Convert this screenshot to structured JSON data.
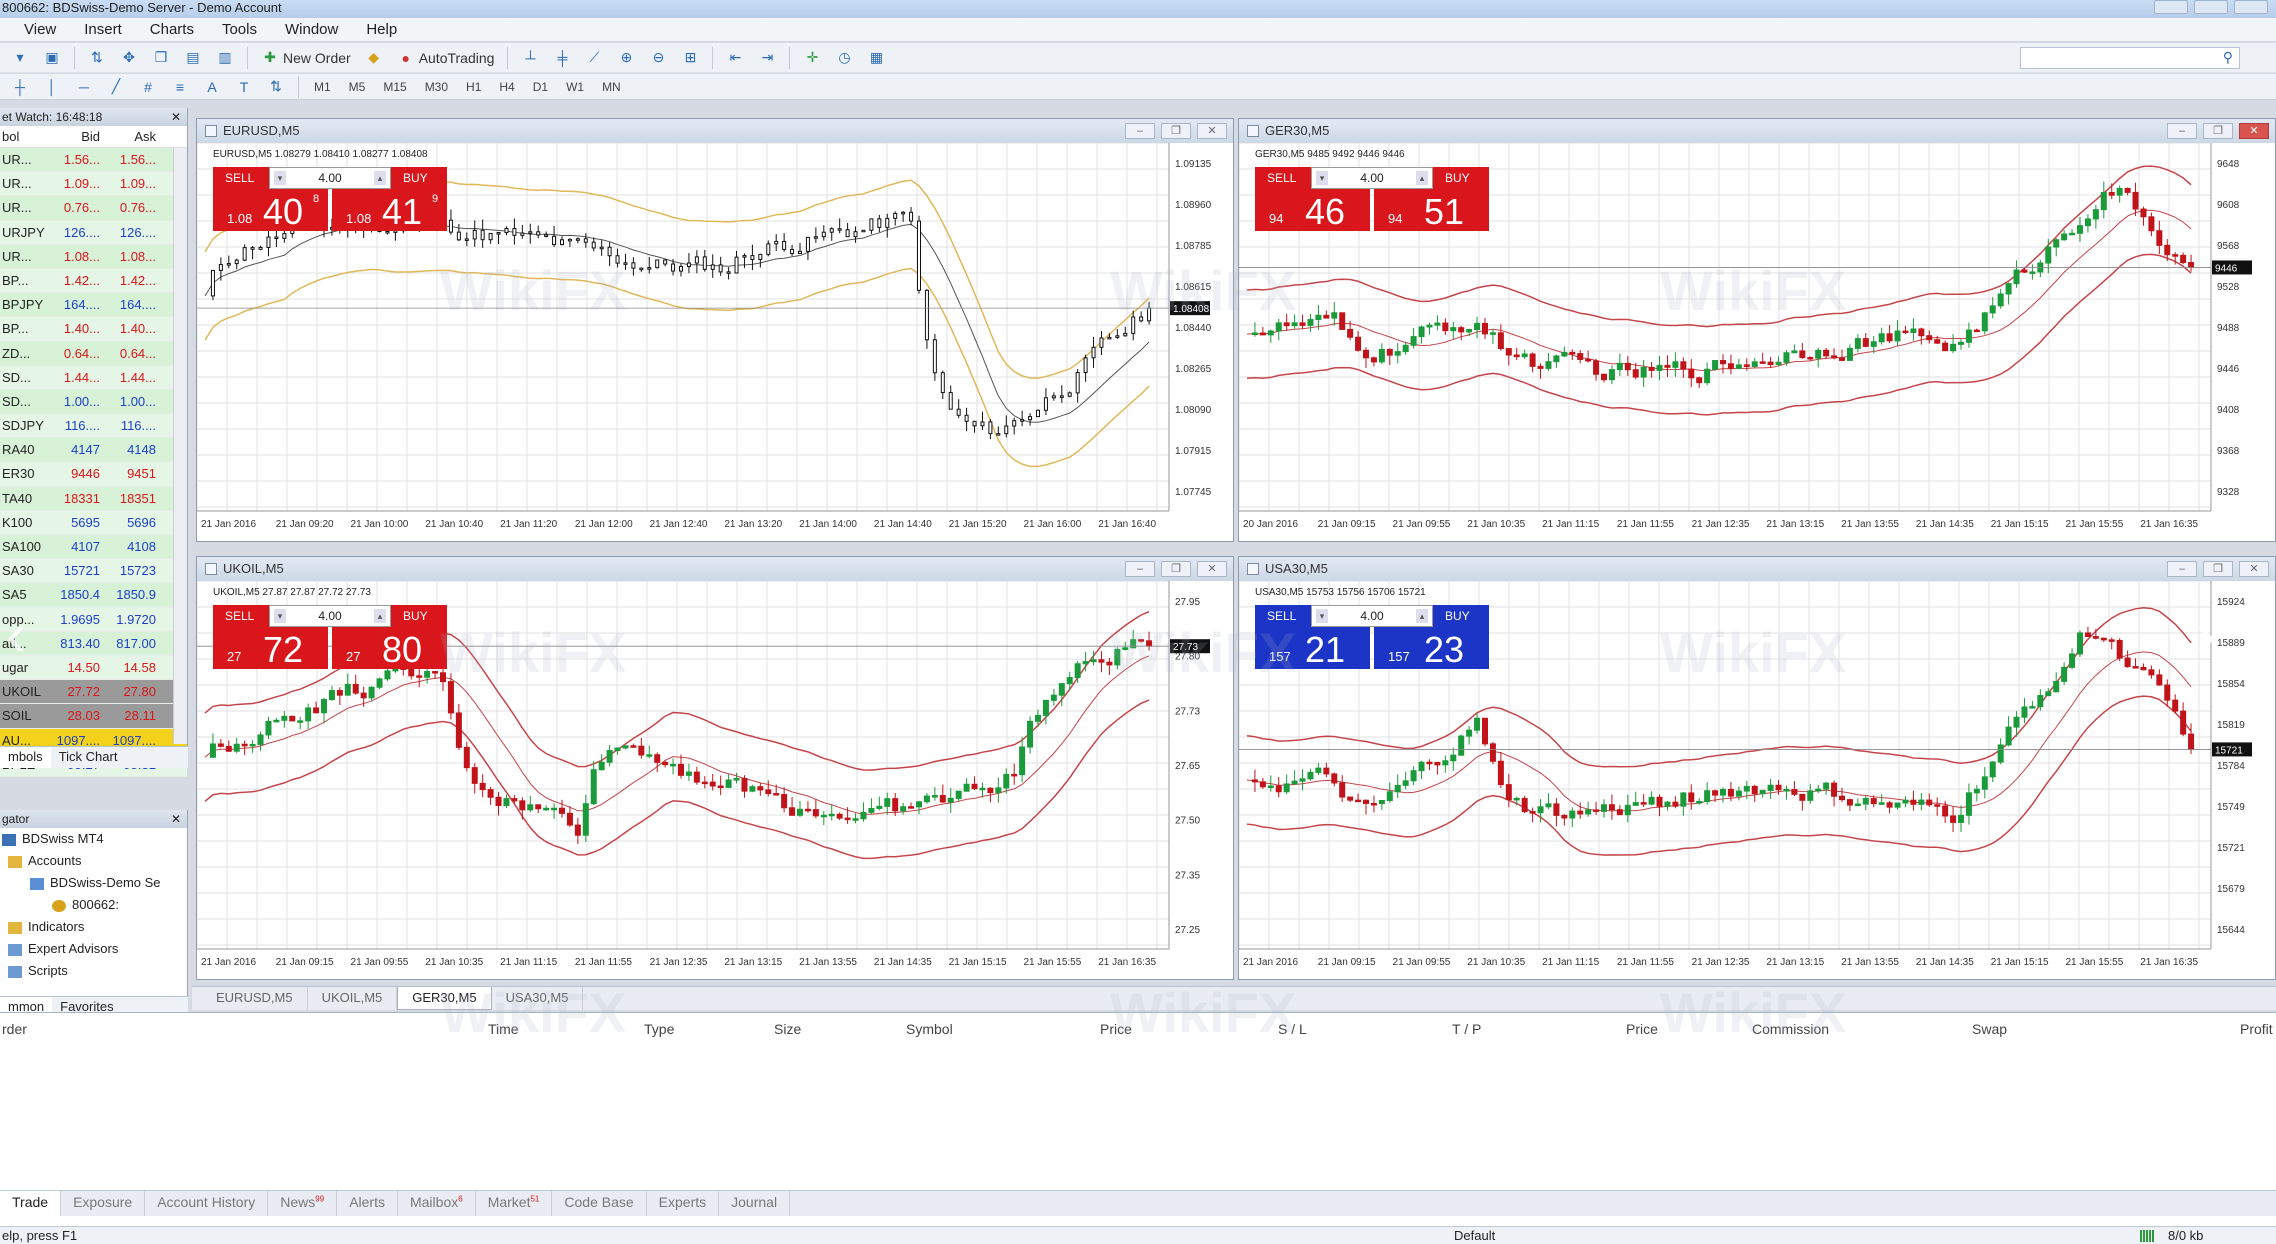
{
  "window": {
    "title": "800662: BDSwiss-Demo Server - Demo Account"
  },
  "menu": [
    "View",
    "Insert",
    "Charts",
    "Tools",
    "Window",
    "Help"
  ],
  "toolbar": {
    "new_order": "New Order",
    "autotrading": "AutoTrading"
  },
  "timeframes": [
    "M1",
    "M5",
    "M15",
    "M30",
    "H1",
    "H4",
    "D1",
    "W1",
    "MN"
  ],
  "market_watch": {
    "title": "et Watch: 16:48:18",
    "headers": {
      "symbol": "bol",
      "bid": "Bid",
      "ask": "Ask"
    },
    "rows": [
      {
        "symbol": "UR...",
        "bid": "1.56...",
        "ask": "1.56...",
        "color": "#d9161b"
      },
      {
        "symbol": "UR...",
        "bid": "1.09...",
        "ask": "1.09...",
        "color": "#d9161b"
      },
      {
        "symbol": "UR...",
        "bid": "0.76...",
        "ask": "0.76...",
        "color": "#d9161b"
      },
      {
        "symbol": "URJPY",
        "bid": "126....",
        "ask": "126....",
        "color": "#1b3fc7"
      },
      {
        "symbol": "UR...",
        "bid": "1.08...",
        "ask": "1.08...",
        "color": "#d9161b"
      },
      {
        "symbol": "BP...",
        "bid": "1.42...",
        "ask": "1.42...",
        "color": "#d9161b"
      },
      {
        "symbol": "BPJPY",
        "bid": "164....",
        "ask": "164....",
        "color": "#1b3fc7"
      },
      {
        "symbol": "BP...",
        "bid": "1.40...",
        "ask": "1.40...",
        "color": "#d9161b"
      },
      {
        "symbol": "ZD...",
        "bid": "0.64...",
        "ask": "0.64...",
        "color": "#d9161b"
      },
      {
        "symbol": "SD...",
        "bid": "1.44...",
        "ask": "1.44...",
        "color": "#d9161b"
      },
      {
        "symbol": "SD...",
        "bid": "1.00...",
        "ask": "1.00...",
        "color": "#1b3fc7"
      },
      {
        "symbol": "SDJPY",
        "bid": "116....",
        "ask": "116....",
        "color": "#1b3fc7"
      },
      {
        "symbol": "RA40",
        "bid": "4147",
        "ask": "4148",
        "color": "#1b3fc7"
      },
      {
        "symbol": "ER30",
        "bid": "9446",
        "ask": "9451",
        "color": "#d9161b"
      },
      {
        "symbol": "TA40",
        "bid": "18331",
        "ask": "18351",
        "color": "#d9161b"
      },
      {
        "symbol": "K100",
        "bid": "5695",
        "ask": "5696",
        "color": "#1b3fc7"
      },
      {
        "symbol": "SA100",
        "bid": "4107",
        "ask": "4108",
        "color": "#1b3fc7"
      },
      {
        "symbol": "SA30",
        "bid": "15721",
        "ask": "15723",
        "color": "#1b3fc7"
      },
      {
        "symbol": "SA5",
        "bid": "1850.4",
        "ask": "1850.9",
        "color": "#1b3fc7"
      },
      {
        "symbol": "opp...",
        "bid": "1.9695",
        "ask": "1.9720",
        "color": "#1b3fc7"
      },
      {
        "symbol": "ati...",
        "bid": "813.40",
        "ask": "817.00",
        "color": "#1b3fc7"
      },
      {
        "symbol": "ugar",
        "bid": "14.50",
        "ask": "14.58",
        "color": "#d9161b"
      },
      {
        "symbol": "UKOIL",
        "bid": "27.72",
        "ask": "27.80",
        "color": "#d9161b"
      },
      {
        "symbol": "SOIL",
        "bid": "28.03",
        "ask": "28.11",
        "color": "#d9161b"
      },
      {
        "symbol": "AU...",
        "bid": "1097....",
        "ask": "1097....",
        "color": "#1b3fc7"
      },
      {
        "symbol": "BPLE",
        "bid": "95.27",
        "ask": "95.31",
        "color": "#1b3fc7"
      }
    ],
    "tabs": [
      "mbols",
      "Tick Chart"
    ]
  },
  "navigator": {
    "title": "gator",
    "items": [
      "BDSwiss MT4",
      "Accounts",
      "BDSwiss-Demo Se",
      "800662:",
      "Indicators",
      "Expert Advisors",
      "Scripts"
    ],
    "tabs": [
      "mmon",
      "Favorites"
    ]
  },
  "charts": [
    {
      "id": "eurusd",
      "title": "EURUSD,M5",
      "info": "EURUSD,M5 1.08279 1.08410 1.08277 1.08408",
      "theme": "red",
      "lot": "4.00",
      "sell_small": "1.08",
      "sell_big": "40",
      "sell_sup": "8",
      "buy_small": "1.08",
      "buy_big": "41",
      "buy_sup": "9",
      "y_ticks": [
        "1.09135",
        "1.08960",
        "1.08785",
        "1.08615",
        "1.08440",
        "1.08265",
        "1.08090",
        "1.07915",
        "1.07745"
      ],
      "current_price": "1.08408",
      "x_ticks": [
        "21 Jan 2016",
        "21 Jan 09:20",
        "21 Jan 10:00",
        "21 Jan 10:40",
        "21 Jan 11:20",
        "21 Jan 12:00",
        "21 Jan 12:40",
        "21 Jan 13:20",
        "21 Jan 14:00",
        "21 Jan 14:40",
        "21 Jan 15:20",
        "21 Jan 16:00",
        "21 Jan 16:40"
      ]
    },
    {
      "id": "ger30",
      "title": "GER30,M5",
      "info": "GER30,M5 9485 9492 9446 9446",
      "theme": "red",
      "lot": "4.00",
      "sell_small": "94",
      "sell_big": "46",
      "sell_sup": "",
      "buy_small": "94",
      "buy_big": "51",
      "buy_sup": "",
      "y_ticks": [
        "9648",
        "9608",
        "9568",
        "9528",
        "9488",
        "9446",
        "9408",
        "9368",
        "9328"
      ],
      "current_price": "9446",
      "x_ticks": [
        "20 Jan 2016",
        "21 Jan 09:15",
        "21 Jan 09:55",
        "21 Jan 10:35",
        "21 Jan 11:15",
        "21 Jan 11:55",
        "21 Jan 12:35",
        "21 Jan 13:15",
        "21 Jan 13:55",
        "21 Jan 14:35",
        "21 Jan 15:15",
        "21 Jan 15:55",
        "21 Jan 16:35"
      ]
    },
    {
      "id": "ukoil",
      "title": "UKOIL,M5",
      "info": "UKOIL,M5 27.87 27.87 27.72 27.73",
      "theme": "red",
      "lot": "4.00",
      "sell_small": "27",
      "sell_big": "72",
      "sell_sup": "",
      "buy_small": "27",
      "buy_big": "80",
      "buy_sup": "",
      "y_ticks": [
        "27.95",
        "27.80",
        "27.73",
        "27.65",
        "27.50",
        "27.35",
        "27.25"
      ],
      "current_price": "27.73",
      "x_ticks": [
        "21 Jan 2016",
        "21 Jan 09:15",
        "21 Jan 09:55",
        "21 Jan 10:35",
        "21 Jan 11:15",
        "21 Jan 11:55",
        "21 Jan 12:35",
        "21 Jan 13:15",
        "21 Jan 13:55",
        "21 Jan 14:35",
        "21 Jan 15:15",
        "21 Jan 15:55",
        "21 Jan 16:35"
      ]
    },
    {
      "id": "usa30",
      "title": "USA30,M5",
      "info": "USA30,M5 15753 15756 15706 15721",
      "theme": "blue",
      "lot": "4.00",
      "sell_small": "157",
      "sell_big": "21",
      "sell_sup": "",
      "buy_small": "157",
      "buy_big": "23",
      "buy_sup": "",
      "y_ticks": [
        "15924",
        "15889",
        "15854",
        "15819",
        "15784",
        "15749",
        "15721",
        "15679",
        "15644"
      ],
      "current_price": "15721",
      "x_ticks": [
        "21 Jan 2016",
        "21 Jan 09:15",
        "21 Jan 09:55",
        "21 Jan 10:35",
        "21 Jan 11:15",
        "21 Jan 11:55",
        "21 Jan 12:35",
        "21 Jan 13:15",
        "21 Jan 13:55",
        "21 Jan 14:35",
        "21 Jan 15:15",
        "21 Jan 15:55",
        "21 Jan 16:35"
      ]
    }
  ],
  "chart_tabs": [
    "EURUSD,M5",
    "UKOIL,M5",
    "GER30,M5",
    "USA30,M5"
  ],
  "terminal": {
    "headers": [
      "rder",
      "Time",
      "Type",
      "Size",
      "Symbol",
      "Price",
      "S / L",
      "T / P",
      "Price",
      "Commission",
      "Swap",
      "Profit"
    ],
    "tabs": [
      "Trade",
      "Exposure",
      "Account History",
      "News",
      "Alerts",
      "Mailbox",
      "Market",
      "Code Base",
      "Experts",
      "Journal"
    ],
    "news_badge": "99",
    "mailbox_badge": "6",
    "market_badge": "51"
  },
  "status": {
    "help": "elp, press F1",
    "profile": "Default",
    "traffic": "8/0 kb"
  },
  "watermark": "WikiFX",
  "colors": {
    "sell": "#d9161b",
    "buy_blue": "#1c35c7",
    "bull": "#1a9a3a",
    "bear": "#c0141a",
    "band": "#c4454a"
  }
}
